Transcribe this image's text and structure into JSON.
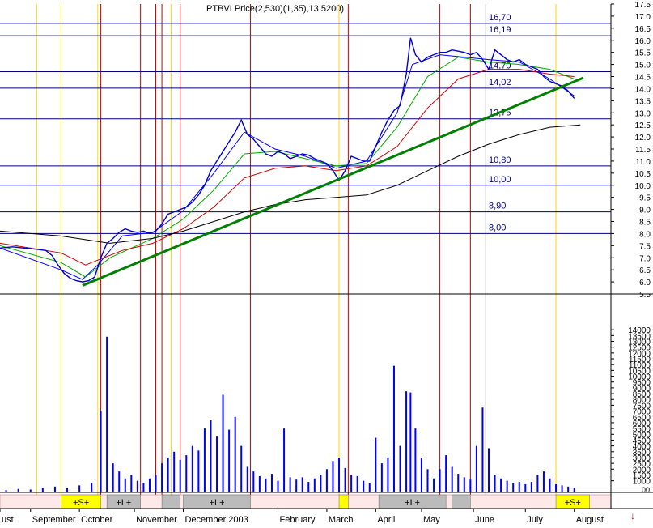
{
  "chart_data": {
    "type": "line",
    "header_text": "PTBVLPrice(2,530)(1,35),13.5200)",
    "x_labels": [
      "ust",
      "September",
      "October",
      "November",
      "December 2003",
      "February",
      "March",
      "April",
      "May",
      "June",
      "July",
      "August"
    ],
    "price_axis": {
      "ylim": [
        5.5,
        17.5
      ],
      "ticks": [
        5.5,
        6.0,
        6.5,
        7.0,
        7.5,
        8.0,
        8.5,
        9.0,
        9.5,
        10.0,
        10.5,
        11.0,
        11.5,
        12.0,
        12.5,
        13.0,
        13.5,
        14.0,
        14.5,
        15.0,
        15.5,
        16.0,
        16.5,
        17.0,
        17.5
      ]
    },
    "volume_axis": {
      "ylim": [
        0,
        14500
      ],
      "ticks": [
        1000,
        1500,
        2000,
        2500,
        3000,
        3500,
        4000,
        4500,
        5000,
        5500,
        6000,
        6500,
        7000,
        7500,
        8000,
        8500,
        9000,
        9500,
        10000,
        10500,
        11000,
        11500,
        12000,
        12500,
        13000,
        13500,
        14000
      ]
    },
    "volume_axis_unit_label": "00",
    "levels": [
      {
        "value": 16.7,
        "label": "16,70"
      },
      {
        "value": 16.19,
        "label": "16,19"
      },
      {
        "value": 14.7,
        "label": "14,70"
      },
      {
        "value": 14.02,
        "label": "14,02"
      },
      {
        "value": 12.75,
        "label": "12,75"
      },
      {
        "value": 10.8,
        "label": "10,80"
      },
      {
        "value": 10.0,
        "label": "10,00"
      },
      {
        "value": 8.9,
        "label": "8,90"
      },
      {
        "value": 8.0,
        "label": "8,00"
      }
    ],
    "trendline": {
      "start": {
        "t": 0.135,
        "value": 5.85
      },
      "end": {
        "t": 0.955,
        "value": 14.45
      }
    },
    "price_series": [
      [
        0.0,
        7.4
      ],
      [
        0.02,
        7.45
      ],
      [
        0.04,
        7.4
      ],
      [
        0.06,
        7.35
      ],
      [
        0.075,
        7.3
      ],
      [
        0.085,
        7.1
      ],
      [
        0.095,
        6.7
      ],
      [
        0.105,
        6.35
      ],
      [
        0.115,
        6.15
      ],
      [
        0.125,
        6.05
      ],
      [
        0.135,
        6.0
      ],
      [
        0.145,
        6.05
      ],
      [
        0.155,
        6.2
      ],
      [
        0.165,
        7.0
      ],
      [
        0.175,
        7.6
      ],
      [
        0.185,
        7.8
      ],
      [
        0.195,
        8.05
      ],
      [
        0.205,
        8.2
      ],
      [
        0.215,
        8.1
      ],
      [
        0.225,
        8.05
      ],
      [
        0.235,
        8.1
      ],
      [
        0.245,
        8.0
      ],
      [
        0.255,
        8.1
      ],
      [
        0.265,
        8.4
      ],
      [
        0.275,
        8.8
      ],
      [
        0.285,
        8.9
      ],
      [
        0.295,
        9.0
      ],
      [
        0.305,
        9.1
      ],
      [
        0.315,
        9.3
      ],
      [
        0.325,
        9.6
      ],
      [
        0.335,
        10.0
      ],
      [
        0.345,
        10.6
      ],
      [
        0.355,
        11.0
      ],
      [
        0.365,
        11.4
      ],
      [
        0.375,
        11.8
      ],
      [
        0.385,
        12.2
      ],
      [
        0.395,
        12.7
      ],
      [
        0.405,
        12.1
      ],
      [
        0.415,
        11.9
      ],
      [
        0.425,
        11.6
      ],
      [
        0.435,
        11.3
      ],
      [
        0.445,
        11.2
      ],
      [
        0.455,
        11.4
      ],
      [
        0.465,
        11.3
      ],
      [
        0.475,
        11.1
      ],
      [
        0.485,
        11.2
      ],
      [
        0.495,
        11.3
      ],
      [
        0.505,
        11.25
      ],
      [
        0.515,
        11.1
      ],
      [
        0.525,
        11.0
      ],
      [
        0.535,
        10.9
      ],
      [
        0.545,
        10.6
      ],
      [
        0.555,
        10.2
      ],
      [
        0.565,
        10.6
      ],
      [
        0.575,
        11.2
      ],
      [
        0.585,
        11.1
      ],
      [
        0.595,
        11.0
      ],
      [
        0.605,
        11.0
      ],
      [
        0.615,
        11.6
      ],
      [
        0.625,
        12.2
      ],
      [
        0.635,
        12.7
      ],
      [
        0.645,
        13.1
      ],
      [
        0.655,
        13.3
      ],
      [
        0.665,
        14.6
      ],
      [
        0.672,
        16.1
      ],
      [
        0.68,
        15.4
      ],
      [
        0.69,
        15.1
      ],
      [
        0.7,
        15.3
      ],
      [
        0.71,
        15.4
      ],
      [
        0.72,
        15.5
      ],
      [
        0.73,
        15.5
      ],
      [
        0.74,
        15.6
      ],
      [
        0.75,
        15.55
      ],
      [
        0.76,
        15.5
      ],
      [
        0.77,
        15.4
      ],
      [
        0.78,
        15.5
      ],
      [
        0.79,
        15.2
      ],
      [
        0.8,
        14.8
      ],
      [
        0.81,
        15.6
      ],
      [
        0.82,
        15.4
      ],
      [
        0.83,
        15.2
      ],
      [
        0.84,
        15.1
      ],
      [
        0.85,
        15.2
      ],
      [
        0.86,
        15.0
      ],
      [
        0.87,
        14.9
      ],
      [
        0.88,
        14.8
      ],
      [
        0.89,
        14.5
      ],
      [
        0.9,
        14.3
      ],
      [
        0.91,
        14.2
      ],
      [
        0.92,
        14.1
      ],
      [
        0.93,
        13.9
      ],
      [
        0.94,
        13.6
      ]
    ],
    "ma_series": [
      {
        "color": "#0000ff",
        "points": [
          [
            0.0,
            7.4
          ],
          [
            0.1,
            6.5
          ],
          [
            0.135,
            6.1
          ],
          [
            0.16,
            6.7
          ],
          [
            0.2,
            7.9
          ],
          [
            0.25,
            8.05
          ],
          [
            0.3,
            8.95
          ],
          [
            0.35,
            10.5
          ],
          [
            0.4,
            12.2
          ],
          [
            0.45,
            11.5
          ],
          [
            0.5,
            11.2
          ],
          [
            0.55,
            10.7
          ],
          [
            0.6,
            11.0
          ],
          [
            0.65,
            13.0
          ],
          [
            0.675,
            15.0
          ],
          [
            0.72,
            15.4
          ],
          [
            0.8,
            15.2
          ],
          [
            0.85,
            15.1
          ],
          [
            0.9,
            14.4
          ],
          [
            0.94,
            13.7
          ]
        ]
      },
      {
        "color": "#00aa00",
        "points": [
          [
            0.0,
            7.5
          ],
          [
            0.1,
            6.8
          ],
          [
            0.14,
            6.2
          ],
          [
            0.18,
            7.0
          ],
          [
            0.25,
            7.8
          ],
          [
            0.3,
            8.6
          ],
          [
            0.35,
            9.8
          ],
          [
            0.4,
            11.3
          ],
          [
            0.45,
            11.4
          ],
          [
            0.5,
            11.1
          ],
          [
            0.55,
            10.8
          ],
          [
            0.6,
            10.9
          ],
          [
            0.65,
            12.4
          ],
          [
            0.7,
            14.5
          ],
          [
            0.75,
            15.3
          ],
          [
            0.8,
            15.1
          ],
          [
            0.85,
            15.0
          ],
          [
            0.9,
            14.8
          ],
          [
            0.94,
            14.4
          ]
        ]
      },
      {
        "color": "#cc0000",
        "points": [
          [
            0.0,
            7.6
          ],
          [
            0.1,
            7.2
          ],
          [
            0.14,
            6.7
          ],
          [
            0.2,
            7.3
          ],
          [
            0.25,
            7.6
          ],
          [
            0.3,
            8.2
          ],
          [
            0.35,
            9.1
          ],
          [
            0.4,
            10.3
          ],
          [
            0.45,
            10.7
          ],
          [
            0.5,
            10.8
          ],
          [
            0.55,
            10.6
          ],
          [
            0.6,
            10.8
          ],
          [
            0.65,
            11.6
          ],
          [
            0.7,
            13.2
          ],
          [
            0.75,
            14.4
          ],
          [
            0.8,
            14.8
          ],
          [
            0.85,
            14.8
          ],
          [
            0.9,
            14.6
          ],
          [
            0.94,
            14.5
          ]
        ]
      },
      {
        "color": "#000000",
        "points": [
          [
            0.0,
            8.1
          ],
          [
            0.1,
            7.9
          ],
          [
            0.18,
            7.6
          ],
          [
            0.25,
            7.8
          ],
          [
            0.3,
            8.1
          ],
          [
            0.35,
            8.5
          ],
          [
            0.4,
            8.9
          ],
          [
            0.45,
            9.2
          ],
          [
            0.5,
            9.4
          ],
          [
            0.55,
            9.5
          ],
          [
            0.6,
            9.6
          ],
          [
            0.65,
            10.0
          ],
          [
            0.7,
            10.6
          ],
          [
            0.75,
            11.2
          ],
          [
            0.8,
            11.7
          ],
          [
            0.85,
            12.1
          ],
          [
            0.9,
            12.4
          ],
          [
            0.95,
            12.5
          ]
        ]
      }
    ],
    "volume_bars": [
      [
        0.01,
        200
      ],
      [
        0.03,
        300
      ],
      [
        0.05,
        250
      ],
      [
        0.07,
        400
      ],
      [
        0.09,
        500
      ],
      [
        0.11,
        350
      ],
      [
        0.13,
        600
      ],
      [
        0.15,
        800
      ],
      [
        0.165,
        7000
      ],
      [
        0.175,
        13400
      ],
      [
        0.185,
        2500
      ],
      [
        0.195,
        1800
      ],
      [
        0.205,
        1200
      ],
      [
        0.215,
        1500
      ],
      [
        0.225,
        1000
      ],
      [
        0.235,
        800
      ],
      [
        0.245,
        1200
      ],
      [
        0.255,
        1500
      ],
      [
        0.265,
        2500
      ],
      [
        0.275,
        3000
      ],
      [
        0.285,
        3500
      ],
      [
        0.295,
        2800
      ],
      [
        0.305,
        3200
      ],
      [
        0.315,
        4000
      ],
      [
        0.325,
        3600
      ],
      [
        0.335,
        5500
      ],
      [
        0.345,
        6200
      ],
      [
        0.355,
        4800
      ],
      [
        0.365,
        8400
      ],
      [
        0.375,
        5400
      ],
      [
        0.385,
        6500
      ],
      [
        0.395,
        4000
      ],
      [
        0.405,
        2200
      ],
      [
        0.415,
        1800
      ],
      [
        0.425,
        1400
      ],
      [
        0.435,
        1200
      ],
      [
        0.445,
        1600
      ],
      [
        0.455,
        1000
      ],
      [
        0.465,
        5500
      ],
      [
        0.475,
        1300
      ],
      [
        0.485,
        1100
      ],
      [
        0.495,
        1300
      ],
      [
        0.505,
        900
      ],
      [
        0.515,
        1200
      ],
      [
        0.525,
        1500
      ],
      [
        0.535,
        2000
      ],
      [
        0.545,
        2700
      ],
      [
        0.555,
        3000
      ],
      [
        0.565,
        2100
      ],
      [
        0.575,
        1500
      ],
      [
        0.585,
        1400
      ],
      [
        0.595,
        1000
      ],
      [
        0.605,
        800
      ],
      [
        0.615,
        4700
      ],
      [
        0.625,
        2500
      ],
      [
        0.635,
        3000
      ],
      [
        0.645,
        10900
      ],
      [
        0.655,
        4000
      ],
      [
        0.665,
        8700
      ],
      [
        0.672,
        8600
      ],
      [
        0.68,
        5500
      ],
      [
        0.69,
        3000
      ],
      [
        0.7,
        2000
      ],
      [
        0.71,
        1200
      ],
      [
        0.72,
        2000
      ],
      [
        0.73,
        3200
      ],
      [
        0.74,
        2200
      ],
      [
        0.75,
        1600
      ],
      [
        0.76,
        1300
      ],
      [
        0.77,
        1100
      ],
      [
        0.78,
        4000
      ],
      [
        0.79,
        7300
      ],
      [
        0.8,
        3800
      ],
      [
        0.81,
        1500
      ],
      [
        0.82,
        1200
      ],
      [
        0.83,
        1000
      ],
      [
        0.84,
        800
      ],
      [
        0.85,
        900
      ],
      [
        0.86,
        700
      ],
      [
        0.87,
        900
      ],
      [
        0.88,
        1500
      ],
      [
        0.89,
        1800
      ],
      [
        0.9,
        1200
      ],
      [
        0.91,
        700
      ],
      [
        0.92,
        600
      ],
      [
        0.93,
        500
      ],
      [
        0.94,
        400
      ]
    ],
    "vertical_markers": [
      {
        "t": 0.06,
        "color": "#ffd700"
      },
      {
        "t": 0.1,
        "color": "#ffd700"
      },
      {
        "t": 0.16,
        "color": "#ffd700"
      },
      {
        "t": 0.165,
        "color": "#cc0000"
      },
      {
        "t": 0.23,
        "color": "#cc0000"
      },
      {
        "t": 0.255,
        "color": "#cc0000"
      },
      {
        "t": 0.265,
        "color": "#cc0000"
      },
      {
        "t": 0.28,
        "color": "#ffd700"
      },
      {
        "t": 0.295,
        "color": "#cc0000"
      },
      {
        "t": 0.41,
        "color": "#cc0000"
      },
      {
        "t": 0.555,
        "color": "#ffd700"
      },
      {
        "t": 0.57,
        "color": "#cc0000"
      },
      {
        "t": 0.72,
        "color": "#cc0000"
      },
      {
        "t": 0.77,
        "color": "#cc0000"
      },
      {
        "t": 0.795,
        "color": "#aaaaaa"
      },
      {
        "t": 0.91,
        "color": "#ffd700"
      }
    ],
    "signal_bands": [
      {
        "label": "+S+",
        "t0": 0.1,
        "t1": 0.165,
        "color": "#ffff00"
      },
      {
        "label": "+L+",
        "t0": 0.175,
        "t1": 0.23,
        "color": "#bbbbbb"
      },
      {
        "label": "",
        "t0": 0.265,
        "t1": 0.295,
        "color": "#bbbbbb"
      },
      {
        "label": "+L+",
        "t0": 0.3,
        "t1": 0.41,
        "color": "#bbbbbb"
      },
      {
        "label": "",
        "t0": 0.555,
        "t1": 0.57,
        "color": "#ffff00"
      },
      {
        "label": "+L+",
        "t0": 0.62,
        "t1": 0.73,
        "color": "#bbbbbb"
      },
      {
        "label": "",
        "t0": 0.74,
        "t1": 0.77,
        "color": "#bbbbbb"
      },
      {
        "label": "+S+",
        "t0": 0.91,
        "t1": 0.965,
        "color": "#ffff00"
      }
    ]
  }
}
